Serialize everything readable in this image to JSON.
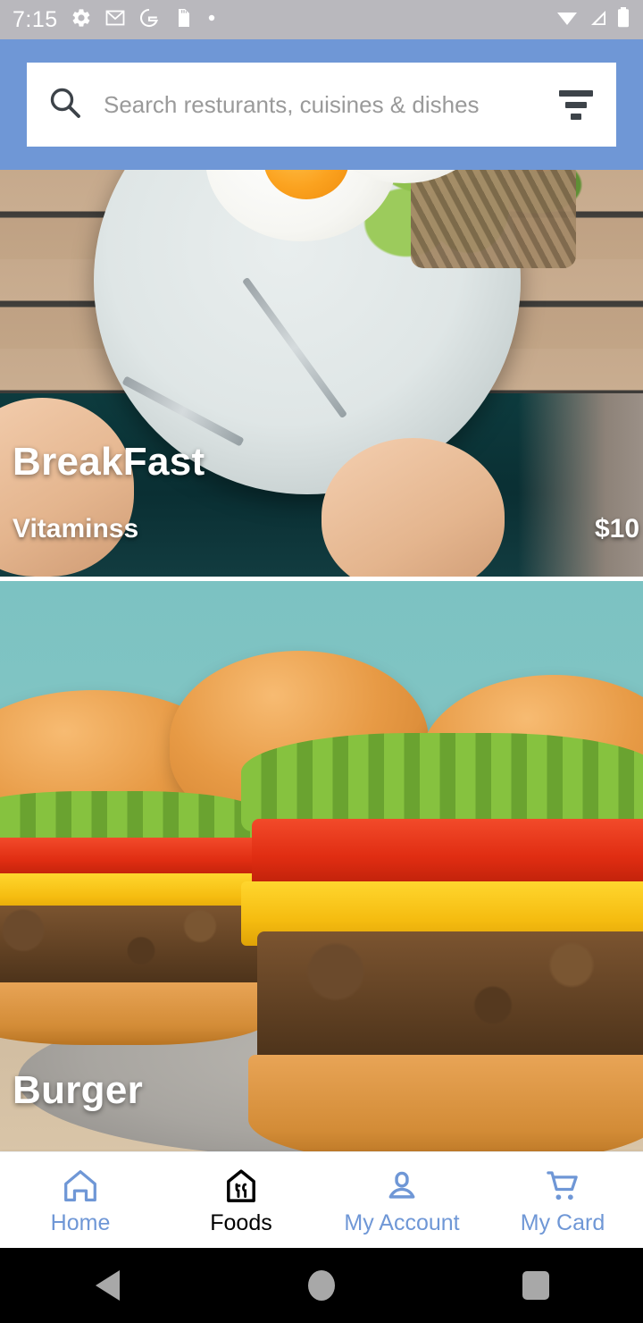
{
  "status_bar": {
    "time": "7:15",
    "left_icons": [
      "gear-icon",
      "gmail-icon",
      "google-icon",
      "sd-card-icon",
      "dot-icon"
    ],
    "right_icons": [
      "wifi-icon",
      "cellular-signal-icon",
      "battery-icon"
    ]
  },
  "header": {
    "background_color": "#6f97d6",
    "search": {
      "placeholder": "Search resturants, cuisines & dishes",
      "value": "",
      "search_icon": "search-icon",
      "filter_icon": "filter-list-icon"
    }
  },
  "cards": [
    {
      "title": "BreakFast",
      "subtitle": "Vitaminss",
      "price": "$10",
      "image_alt": "fried eggs with greens and sausages on a plate"
    },
    {
      "title": "Burger",
      "subtitle": "",
      "price": "",
      "image_alt": "veggie burger with lettuce tomato and cheese"
    }
  ],
  "tab_bar": {
    "active_color": "#000000",
    "inactive_color": "#6f97d6",
    "tabs": [
      {
        "label": "Home",
        "icon": "home-icon",
        "active": false
      },
      {
        "label": "Foods",
        "icon": "restaurant-icon",
        "active": true
      },
      {
        "label": "My Account",
        "icon": "person-icon",
        "active": false
      },
      {
        "label": "My Card",
        "icon": "shopping-cart-icon",
        "active": false
      }
    ]
  },
  "android_nav": {
    "back": "back-triangle-icon",
    "home": "home-circle-icon",
    "recents": "recents-square-icon"
  }
}
